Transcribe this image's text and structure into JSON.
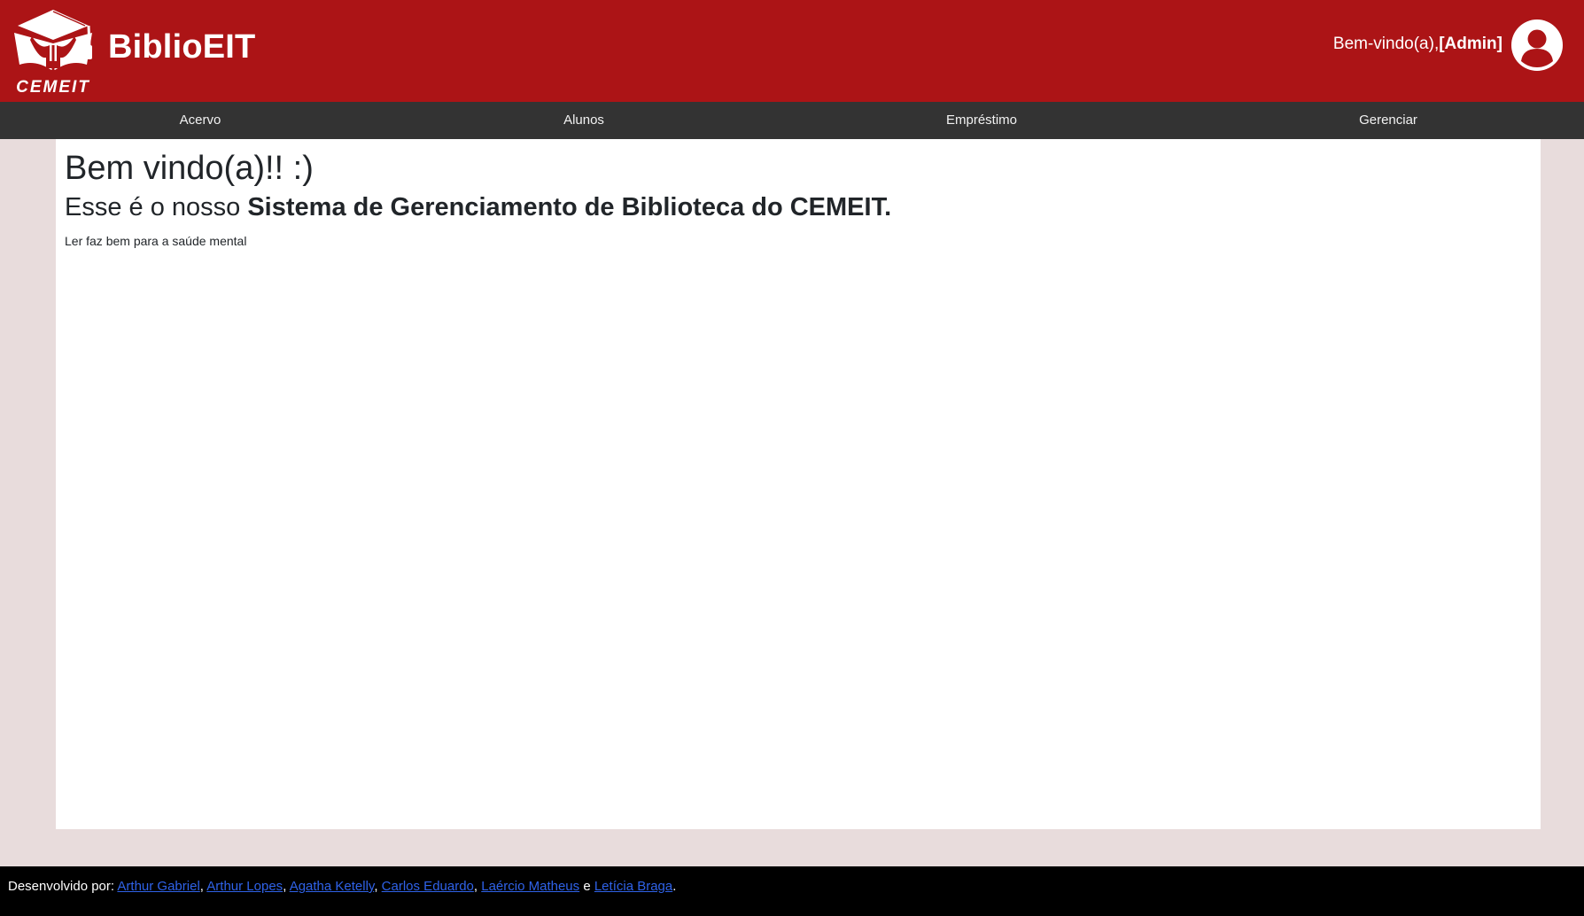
{
  "header": {
    "brand": "BiblioEIT",
    "logo_text": "CEMEIT",
    "welcome_prefix": "Bem-vindo(a),",
    "welcome_user": "[Admin]",
    "icons": {
      "logo": "graduation-cap-person-logo",
      "account": "user-circle-icon"
    }
  },
  "nav": {
    "items": [
      {
        "label": "Acervo"
      },
      {
        "label": "Alunos"
      },
      {
        "label": "Empréstimo"
      },
      {
        "label": "Gerenciar"
      }
    ]
  },
  "main": {
    "title": "Bem vindo(a)!! :)",
    "subtitle_prefix": "Esse é o nosso ",
    "subtitle_bold": "Sistema de Gerenciamento de Biblioteca do CEMEIT.",
    "tagline": "Ler faz bem para a saúde mental"
  },
  "footer": {
    "prefix": "Desenvolvido por: ",
    "developers": [
      "Arthur Gabriel",
      "Arthur Lopes",
      "Agatha Ketelly",
      "Carlos Eduardo",
      "Laércio Matheus",
      "Letícia Braga"
    ],
    "separator": ", ",
    "conjunction": " e ",
    "suffix": "."
  },
  "colors": {
    "header_bg": "#ac1416",
    "nav_bg": "#333333",
    "page_bg": "#e8dcdc",
    "card_bg": "#ffffff",
    "footer_bg": "#000000",
    "link": "#2f62e8"
  }
}
